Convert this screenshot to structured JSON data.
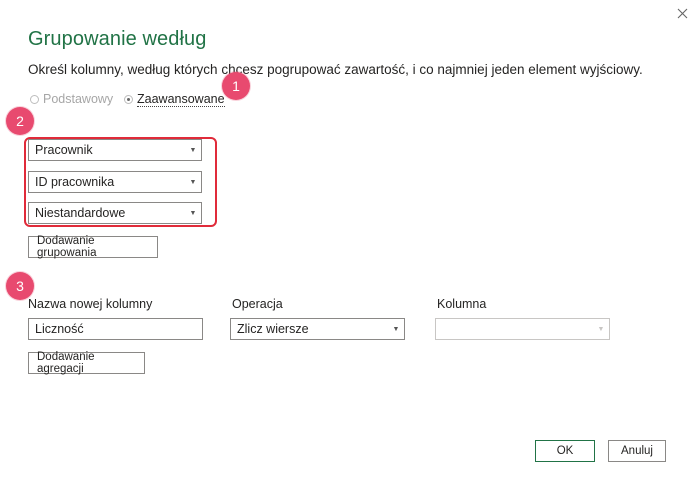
{
  "dialog": {
    "title": "Grupowanie według",
    "subtitle": "Określ kolumny, według których chcesz pogrupować zawartość, i co najmniej jeden element wyjściowy.",
    "close_glyph": "✕",
    "accent_color": "#217346"
  },
  "mode": {
    "basic_label": "Podstawowy",
    "advanced_label": "Zaawansowane",
    "selected": "Zaawansowane"
  },
  "badges": [
    "1",
    "2",
    "3"
  ],
  "badge_color": "#e84a6f",
  "grouping": {
    "columns": [
      {
        "value": "Pracownik"
      },
      {
        "value": "ID pracownika"
      },
      {
        "value": "Niestandardowe"
      }
    ],
    "add_button": "Dodawanie grupowania"
  },
  "aggregation": {
    "headers": {
      "new_column": "Nazwa nowej kolumny",
      "operation": "Operacja",
      "column": "Kolumna"
    },
    "row": {
      "new_column_value": "Liczność",
      "operation_value": "Zlicz wiersze",
      "column_value": ""
    },
    "add_button": "Dodawanie agregacji"
  },
  "footer": {
    "ok": "OK",
    "cancel": "Anuluj"
  }
}
